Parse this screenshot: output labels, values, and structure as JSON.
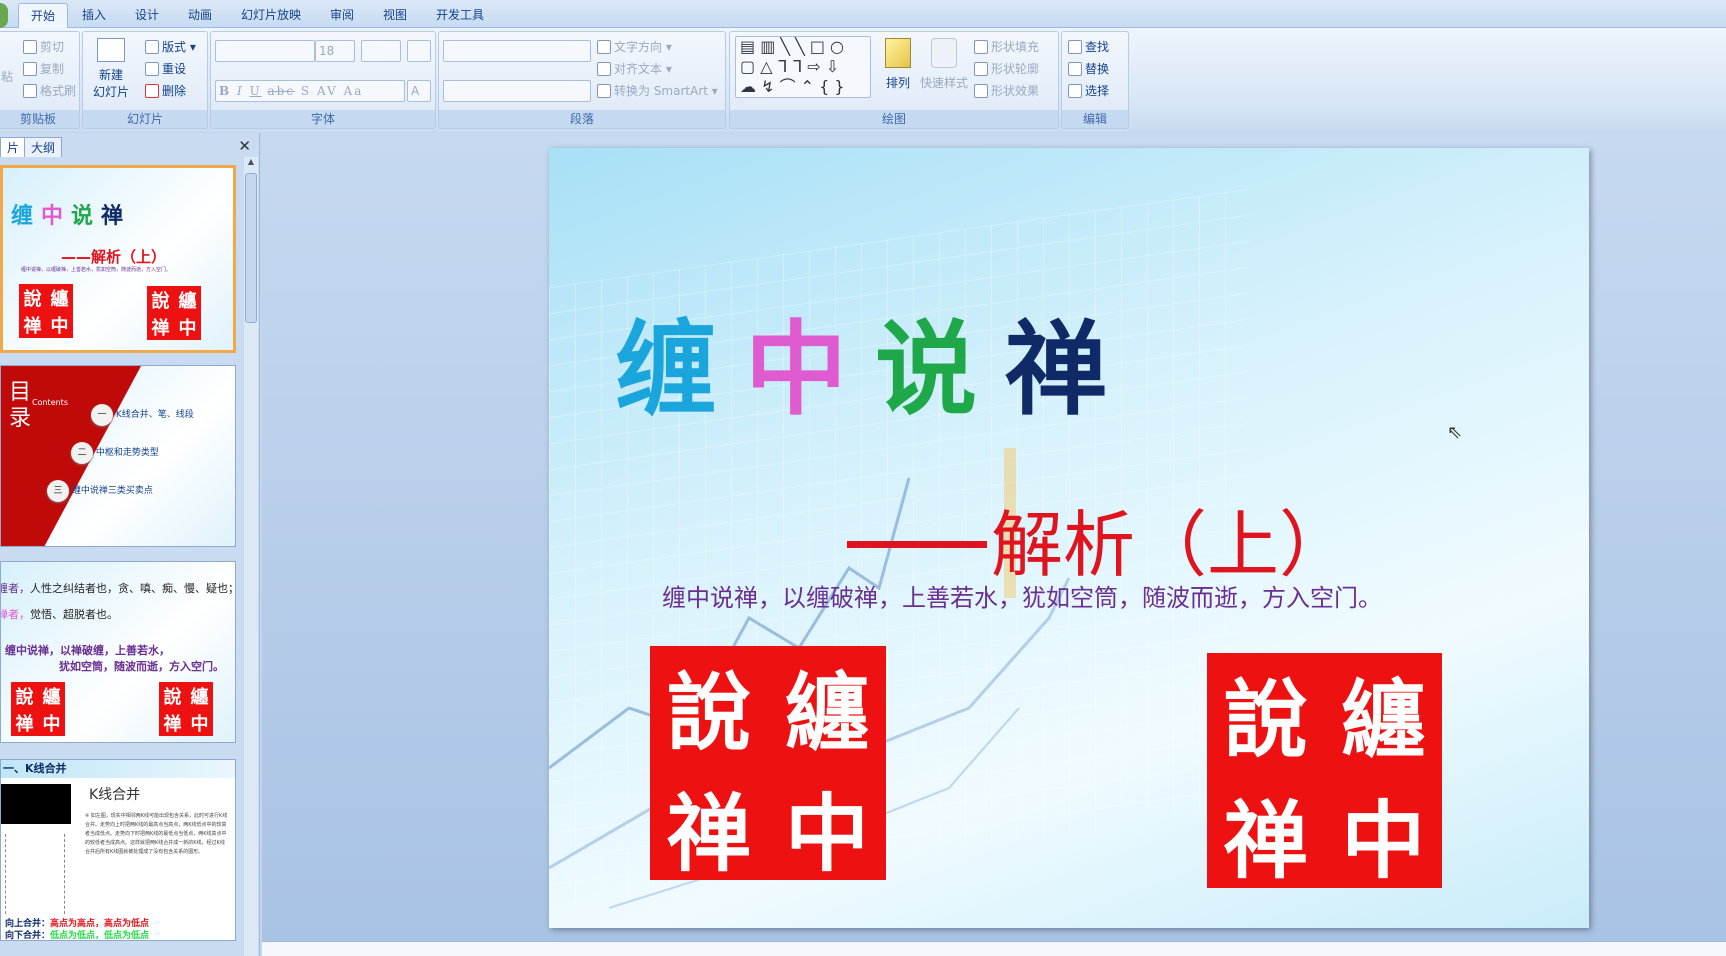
{
  "ribbon_tabs": [
    "开始",
    "插入",
    "设计",
    "动画",
    "幻灯片放映",
    "审阅",
    "视图",
    "开发工具"
  ],
  "active_tab": "开始",
  "groups": {
    "clipboard": {
      "label": "剪贴板",
      "paste": "粘",
      "cut": "剪切",
      "copy": "复制",
      "format_painter": "格式刷"
    },
    "slides": {
      "label": "幻灯片",
      "new_slide_1": "新建",
      "new_slide_2": "幻灯片",
      "layout": "版式",
      "reset": "重设",
      "delete": "删除"
    },
    "font": {
      "label": "字体",
      "font_name": "",
      "font_size": "18",
      "bold": "B",
      "italic": "I",
      "underline": "U",
      "strike": "abc",
      "shadow": "S",
      "spacing": "AV",
      "case": "Aa",
      "color": "A"
    },
    "paragraph": {
      "label": "段落",
      "text_direction": "文字方向",
      "align_text": "对齐文本",
      "smartart": "转换为 SmartArt"
    },
    "drawing": {
      "label": "绘图",
      "arrange": "排列",
      "quick_styles": "快速样式",
      "shape_fill": "形状填充",
      "shape_outline": "形状轮廓",
      "shape_effects": "形状效果"
    },
    "editing": {
      "label": "编辑",
      "find": "查找",
      "replace": "替换",
      "select": "选择"
    }
  },
  "panel": {
    "tab_slides": "片",
    "tab_outline": "大纲",
    "close": "✕"
  },
  "thumbnails": [
    {
      "title": [
        "缠",
        "中",
        "说",
        "禅"
      ],
      "subtitle": "——解析（上）",
      "motto": "缠中说禅，以缠破禅，上善若水，犹如空筒，随波而逝，方入空门。"
    },
    {
      "heading": "目录",
      "heading_en": "Contents",
      "items": [
        {
          "num": "一",
          "text": "K线合并、笔、线段"
        },
        {
          "num": "二",
          "text": "中枢和走势类型"
        },
        {
          "num": "三",
          "text": "缠中说禅三类买卖点"
        }
      ]
    },
    {
      "line1_key": "缠者，",
      "line1": "人性之纠结者也，贪、嗔、痴、慢、疑也；",
      "line2_key": "禅者，",
      "line2": "觉悟、超脱者也。",
      "line3": "缠中说禅，以禅破缠，上善若水，",
      "line4": "犹如空筒，随波而逝，方入空门。"
    },
    {
      "header": "一、K线合并",
      "title": "K线合并",
      "body": "※ 如左图，现实中相邻两K线可能出现包含关系，此时可进行K线合并。走势向上时把两K线的最高点当高点，两K线低点中的较高者当成低点。走势向下时把两K线的最低点当低点，两K线高点中的较低者当成高点。这样就把两K线合并成一新的K线，经过K线合并后所有K线图就被处理成了没有包含关系的图形。",
      "up_label": "向上合并：",
      "up_rule": "高点为高点，高点为低点",
      "down_label": "向下合并：",
      "down_rule": "低点为低点，低点为低点"
    }
  ],
  "slide": {
    "title": [
      {
        "char": "缠",
        "color": "#1aa6dc"
      },
      {
        "char": "中",
        "color": "#e05ad0"
      },
      {
        "char": "说",
        "color": "#1ea84a"
      },
      {
        "char": "禅",
        "color": "#0f2a66"
      }
    ],
    "subtitle": "解析（上）",
    "motto": "缠中说禅，以缠破禅，上善若水，犹如空筒，随波而逝，方入空门。",
    "seal_chars": [
      "說",
      "纏",
      "禅",
      "中"
    ],
    "seal_color": "#ee1111"
  }
}
